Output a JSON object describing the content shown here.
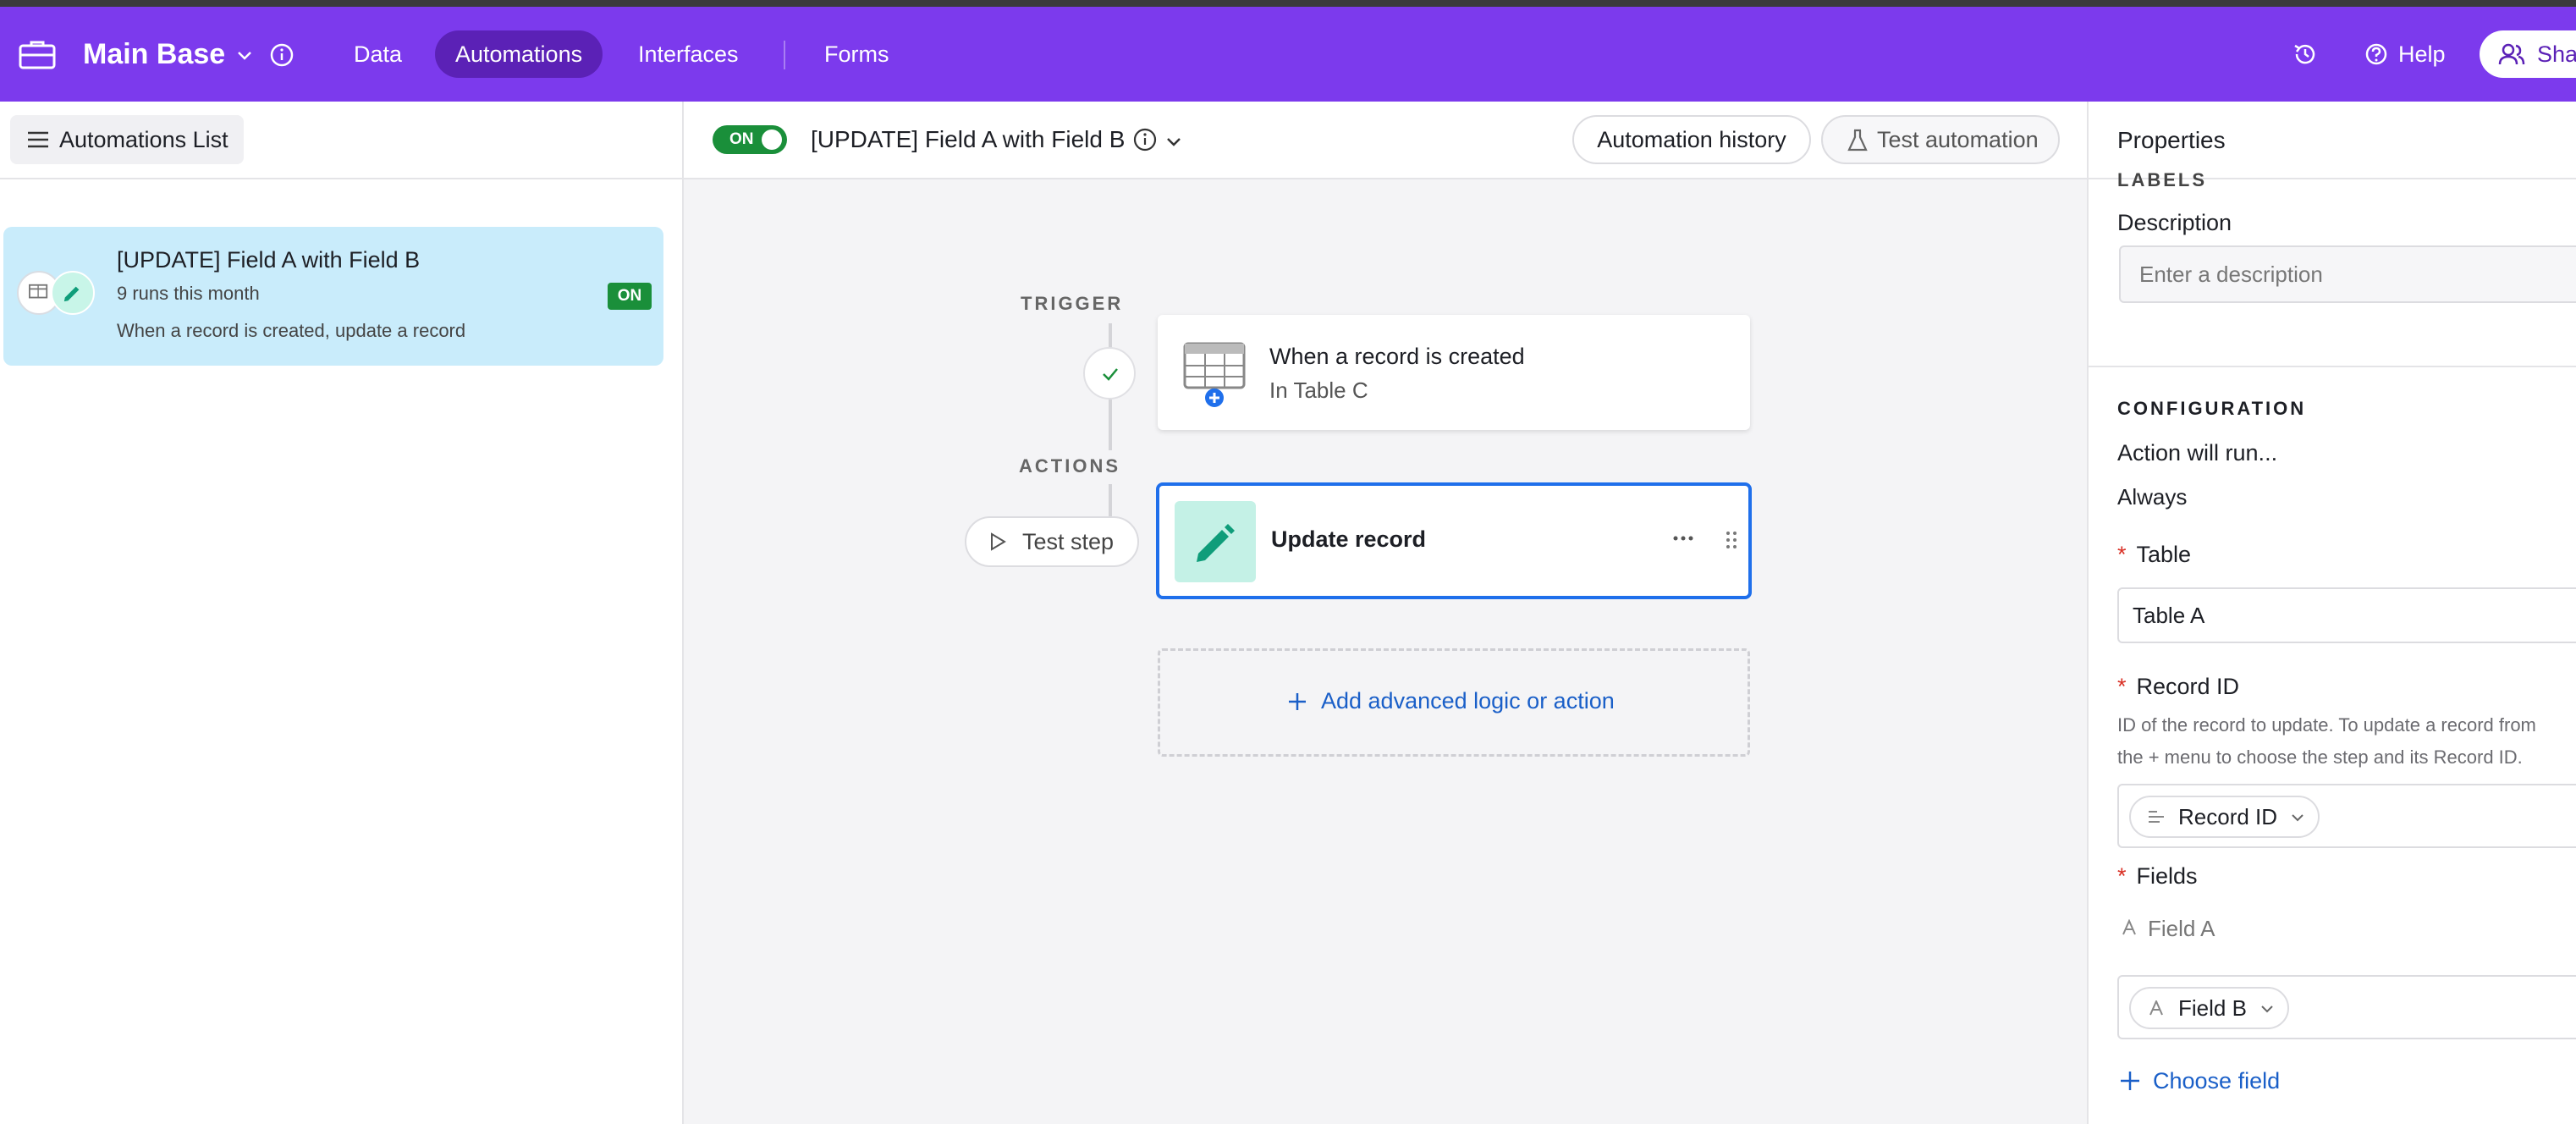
{
  "topbar": {
    "base_name": "Main Base",
    "nav": [
      "Data",
      "Automations",
      "Interfaces",
      "Forms"
    ],
    "help": "Help",
    "share": "Share",
    "accent": "#7c3aed"
  },
  "left": {
    "list_button": "Automations List",
    "automation": {
      "name": "[UPDATE] Field A with Field B",
      "runs": "9 runs this month",
      "summary": "When a record is created, update a record",
      "status": "ON"
    }
  },
  "center": {
    "toggle": "ON",
    "title": "[UPDATE] Field A with Field B",
    "history_button": "Automation history",
    "test_button": "Test automation",
    "trigger_label": "TRIGGER",
    "actions_label": "ACTIONS",
    "trigger": {
      "title": "When a record is created",
      "subtitle": "In Table C"
    },
    "test_step": "Test step",
    "action": {
      "title": "Update record"
    },
    "add_logic": "Add advanced logic or action"
  },
  "properties": {
    "title": "Properties",
    "labels_cut": "LABELS",
    "description_label": "Description",
    "description_placeholder": "Enter a description",
    "config_heading": "CONFIGURATION",
    "action_will_run": "Action will run...",
    "always": "Always",
    "table_label": "Table",
    "table_value": "Table A",
    "record_id_label": "Record ID",
    "record_id_help_1": "ID of the record to update. To update a record from",
    "record_id_help_2": "the + menu to choose the step and its Record ID.",
    "record_id_pill": "Record ID",
    "fields_label": "Fields",
    "field_a": "Field A",
    "field_b_pill": "Field B",
    "choose_field": "Choose field",
    "required_mark": "*"
  }
}
